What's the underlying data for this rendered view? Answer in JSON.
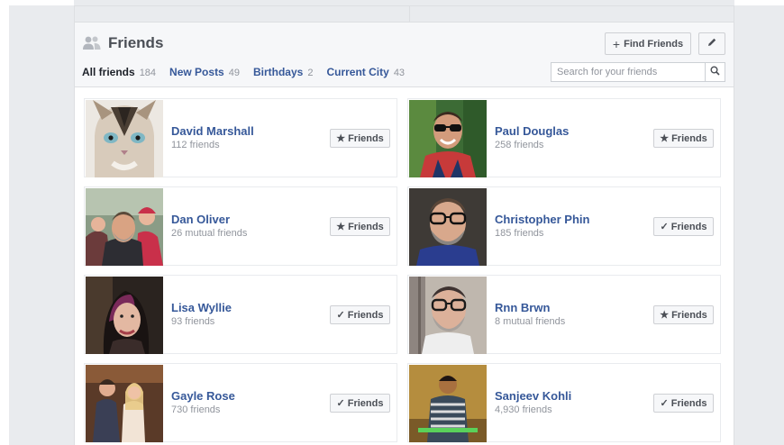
{
  "header": {
    "title": "Friends",
    "find_friends_label": "Find Friends",
    "find_friends_icon": "+",
    "search_placeholder": "Search for your friends"
  },
  "tabs": [
    {
      "label": "All friends",
      "count": "184",
      "active": true
    },
    {
      "label": "New Posts",
      "count": "49",
      "active": false
    },
    {
      "label": "Birthdays",
      "count": "2",
      "active": false
    },
    {
      "label": "Current City",
      "count": "43",
      "active": false
    }
  ],
  "friends": [
    {
      "name": "David Marshall",
      "sub": "112 friends",
      "button": "Friends",
      "icon": "★",
      "icon_name": "star-icon"
    },
    {
      "name": "Paul Douglas",
      "sub": "258 friends",
      "button": "Friends",
      "icon": "★",
      "icon_name": "star-icon"
    },
    {
      "name": "Dan Oliver",
      "sub": "26 mutual friends",
      "button": "Friends",
      "icon": "★",
      "icon_name": "star-icon"
    },
    {
      "name": "Christopher Phin",
      "sub": "185 friends",
      "button": "Friends",
      "icon": "✓",
      "icon_name": "check-icon"
    },
    {
      "name": "Lisa Wyllie",
      "sub": "93 friends",
      "button": "Friends",
      "icon": "✓",
      "icon_name": "check-icon"
    },
    {
      "name": "Rnn Brwn",
      "sub": "8 mutual friends",
      "button": "Friends",
      "icon": "★",
      "icon_name": "star-icon"
    },
    {
      "name": "Gayle Rose",
      "sub": "730 friends",
      "button": "Friends",
      "icon": "✓",
      "icon_name": "check-icon"
    },
    {
      "name": "Sanjeev Kohli",
      "sub": "4,930 friends",
      "button": "Friends",
      "icon": "✓",
      "icon_name": "check-icon"
    }
  ],
  "colors": {
    "link": "#365899",
    "muted": "#90949c",
    "header_bg": "#f6f7f9",
    "page_bg": "#e9ebee"
  }
}
